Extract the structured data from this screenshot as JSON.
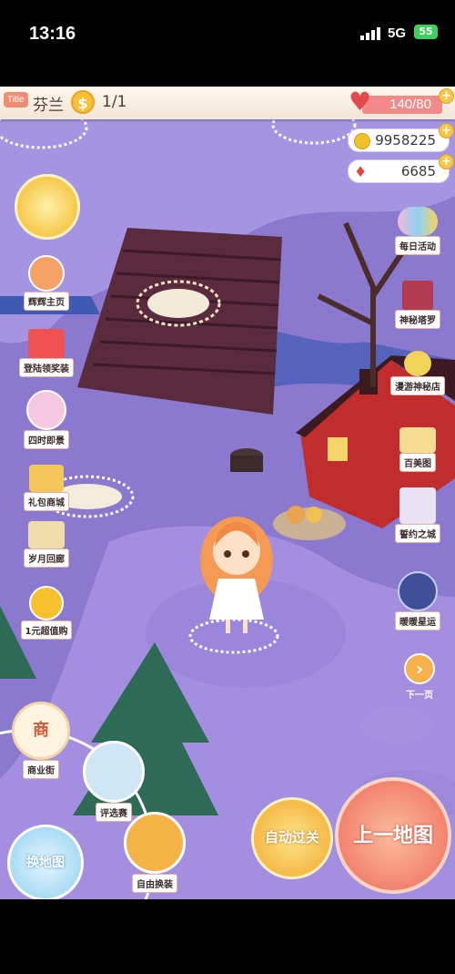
{
  "status_bar": {
    "time": "13:16",
    "network": "5G",
    "battery": "55"
  },
  "top_bar": {
    "title_badge": "Title",
    "player_name": "芬兰",
    "coin_symbol": "$",
    "ratio": "1/1",
    "hp": "140/80"
  },
  "resources": {
    "gold": "9958225",
    "gems": "6685"
  },
  "left_menu": [
    {
      "label": "辉辉主页"
    },
    {
      "label": "登陆领奖装"
    },
    {
      "label": "四时即景"
    },
    {
      "label": "礼包商城"
    },
    {
      "label": "岁月回廊"
    },
    {
      "label": "1元超值购"
    }
  ],
  "right_menu": [
    {
      "label": "每日活动"
    },
    {
      "label": "神秘塔罗"
    },
    {
      "label": "漫游神秘店"
    },
    {
      "label": "百美图"
    },
    {
      "label": "誓约之城"
    },
    {
      "label": "暖暖星运"
    }
  ],
  "next_page": {
    "label": "下一页"
  },
  "bottom_menu": {
    "shop_street": "商业街",
    "shop_icon": "商",
    "contest": "评选赛",
    "free_dress": "自由换装",
    "map_icon": "换地图"
  },
  "actions": {
    "auto_pass": "自动过关",
    "prev_map": "上一地图"
  },
  "colors": {
    "ground": "#8b79cf",
    "path": "#a48ee0",
    "accent": "#f28a8a"
  }
}
